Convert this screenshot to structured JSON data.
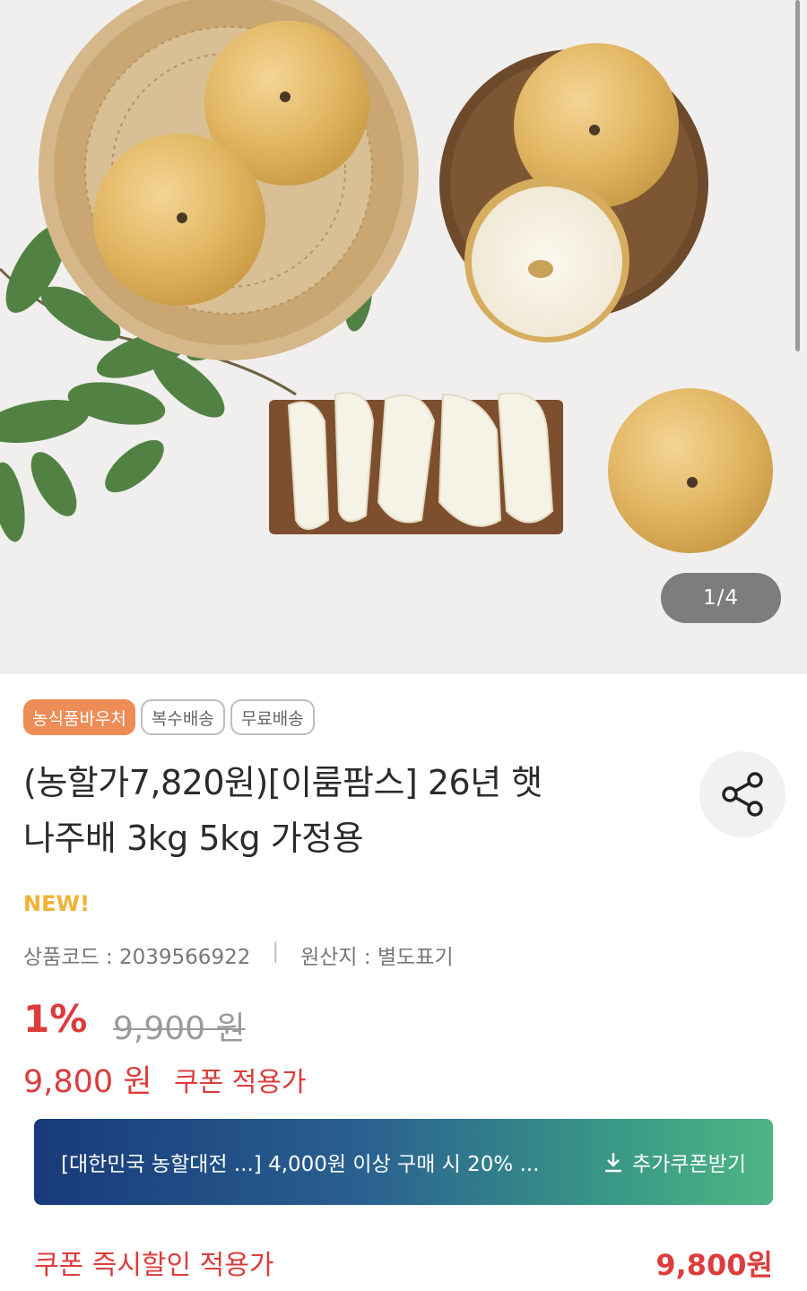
{
  "gallery": {
    "counter": "1/4"
  },
  "badges": [
    {
      "label": "농식품바우처"
    },
    {
      "label": "복수배송"
    },
    {
      "label": "무료배송"
    }
  ],
  "product": {
    "title_line1": "(농할가7,820원)[이룸팜스] 26년 햇",
    "title_line2": "나주배 3kg 5kg 가정용",
    "new_tag": "NEW!",
    "code_label": "상품코드 : 2039566922",
    "separator": "|",
    "origin_label": "원산지 : 별도표기"
  },
  "price": {
    "discount": "1%",
    "original": "9,900 원",
    "sale": "9,800 원",
    "sale_label": "쿠폰 적용가"
  },
  "coupon": {
    "text": "[대한민국 농할대전 ...] 4,000원 이상 구매 시 20% ...",
    "button": "추가쿠폰받기",
    "icon": "download-icon"
  },
  "instant": {
    "label": "쿠폰 즉시할인 적용가",
    "price": "9,800원"
  },
  "colors": {
    "accent_red": "#dc3c3c",
    "badge_orange": "#ee8c57",
    "new_yellow": "#f2b233",
    "coupon_gradient_start": "#183a7a",
    "coupon_gradient_end": "#4fb583"
  }
}
